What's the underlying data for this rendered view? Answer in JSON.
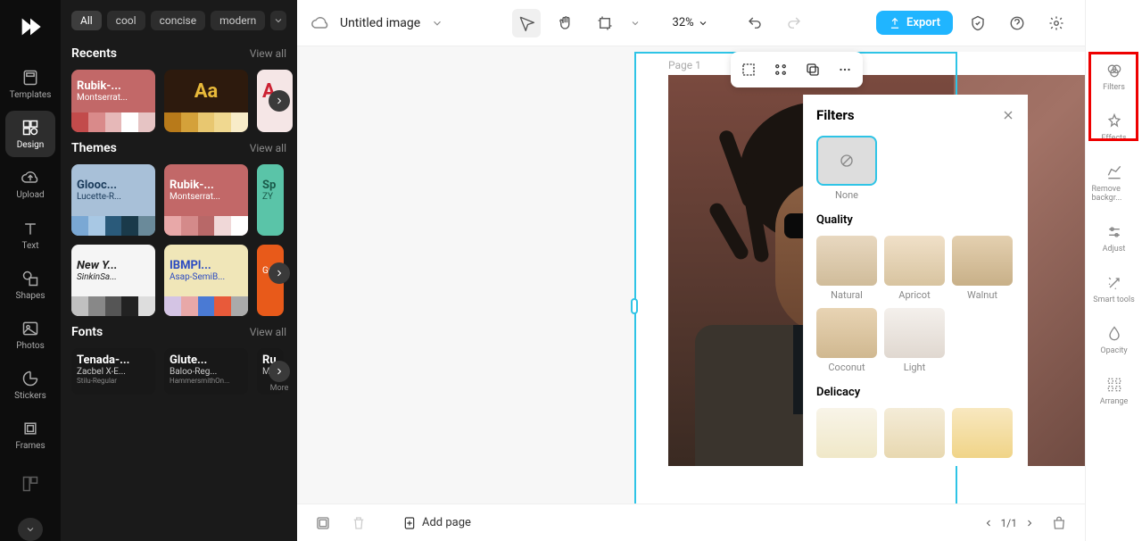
{
  "left_toolbar": {
    "items": [
      "Templates",
      "Design",
      "Upload",
      "Text",
      "Shapes",
      "Photos",
      "Stickers",
      "Frames"
    ],
    "active": "Design"
  },
  "tags": {
    "items": [
      "All",
      "cool",
      "concise",
      "modern"
    ],
    "active": "All"
  },
  "recents": {
    "title": "Recents",
    "view_all": "View all",
    "cards": [
      {
        "t1": "Rubik-...",
        "t2": "Montserrat...",
        "colors": [
          "#c24b4b",
          "#d98a8a",
          "#e6b8b8",
          "#fff",
          "#e6c4c4"
        ]
      },
      {
        "t1": "Aa",
        "t2": "",
        "bg": "#2d1a0d",
        "fg": "#e8b93a",
        "colors": [
          "#b87a1a",
          "#d4a13a",
          "#e8c770",
          "#f0d890",
          "#f8ecc8"
        ]
      },
      {
        "t1": "A",
        "t2": "",
        "bg": "#f5e6e6",
        "fg": "#c23"
      }
    ]
  },
  "themes": {
    "title": "Themes",
    "view_all": "View all",
    "cards": [
      {
        "t1": "Glooc...",
        "t2": "Lucette-R...",
        "bg": "#a8c0d8",
        "fg": "#1a3a5a",
        "colors": [
          "#7aa8d4",
          "#a8c8e4",
          "#2a5a7a",
          "#1a3a4a",
          "#6a8a9a"
        ]
      },
      {
        "t1": "Rubik-...",
        "t2": "Montserrat...",
        "bg": "#c26868",
        "fg": "#fff",
        "colors": [
          "#e8a8a8",
          "#d48a8a",
          "#b86868",
          "#f0d8d8",
          "#fff"
        ]
      },
      {
        "t1": "Sp",
        "t2": "ZY",
        "bg": "#5ac4a8",
        "fg": "#1a5a4a"
      },
      {
        "t1": "New Y...",
        "t2": "SinkinSa...",
        "bg": "#f5f5f5",
        "fg": "#222",
        "colors": [
          "#c0c0c0",
          "#888",
          "#555",
          "#222",
          "#ddd"
        ]
      },
      {
        "t1": "IBMPl...",
        "t2": "Asap-SemiB...",
        "bg": "#f0e6b8",
        "fg": "#2a4ac2",
        "colors": [
          "#d4c4e4",
          "#e8a8a8",
          "#4a7ad4",
          "#e85a3a",
          "#aaa"
        ]
      },
      {
        "t1": "",
        "t2": "Gro",
        "bg": "#e85a1a",
        "fg": "#fff"
      }
    ]
  },
  "fonts": {
    "title": "Fonts",
    "view_all": "View all",
    "more": "More",
    "cards": [
      {
        "f1": "Tenada-...",
        "f2": "Zacbel X-E...",
        "f3": "Stilu-Regular"
      },
      {
        "f1": "Glute...",
        "f2": "Baloo-Reg...",
        "f3": "HammersmithOn..."
      },
      {
        "f1": "Ru",
        "f2": "Mon"
      }
    ]
  },
  "doc": {
    "name": "Untitled image",
    "zoom": "32%",
    "page_label": "Page 1"
  },
  "export_label": "Export",
  "bottom": {
    "add_page": "Add page",
    "page_count": "1/1"
  },
  "filters": {
    "title": "Filters",
    "none": "None",
    "quality": {
      "title": "Quality",
      "items": [
        "Natural",
        "Apricot",
        "Walnut",
        "Coconut",
        "Light"
      ]
    },
    "delicacy": {
      "title": "Delicacy"
    }
  },
  "right_toolbar": {
    "items": [
      "Filters",
      "Effects",
      "Remove backgr...",
      "Adjust",
      "Smart tools",
      "Opacity",
      "Arrange"
    ]
  }
}
